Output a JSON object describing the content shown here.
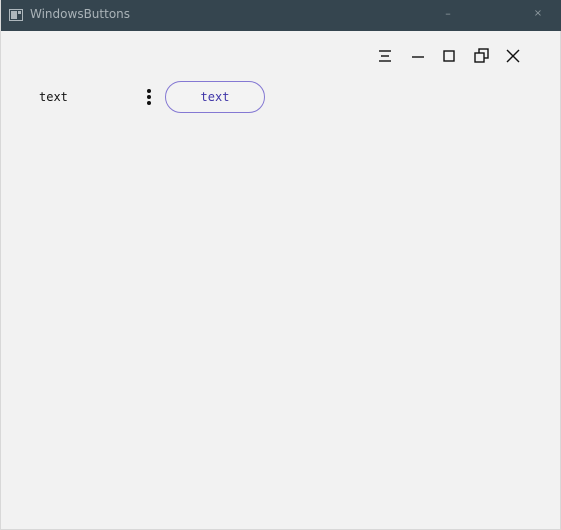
{
  "window": {
    "title": "WindowsButtons",
    "titlebar_minimize_glyph": "–",
    "titlebar_close_glyph": "×"
  },
  "toolbar": {
    "icons": [
      "menu-icon",
      "minimize-icon",
      "maximize-icon",
      "restore-icon",
      "close-icon"
    ]
  },
  "content": {
    "label_text": "text",
    "button_text": "text"
  },
  "colors": {
    "titlebar": "#35454f",
    "background": "#f2f2f2",
    "accent": "#3f35a8",
    "button_border": "#8478d3",
    "icon": "#111111"
  }
}
